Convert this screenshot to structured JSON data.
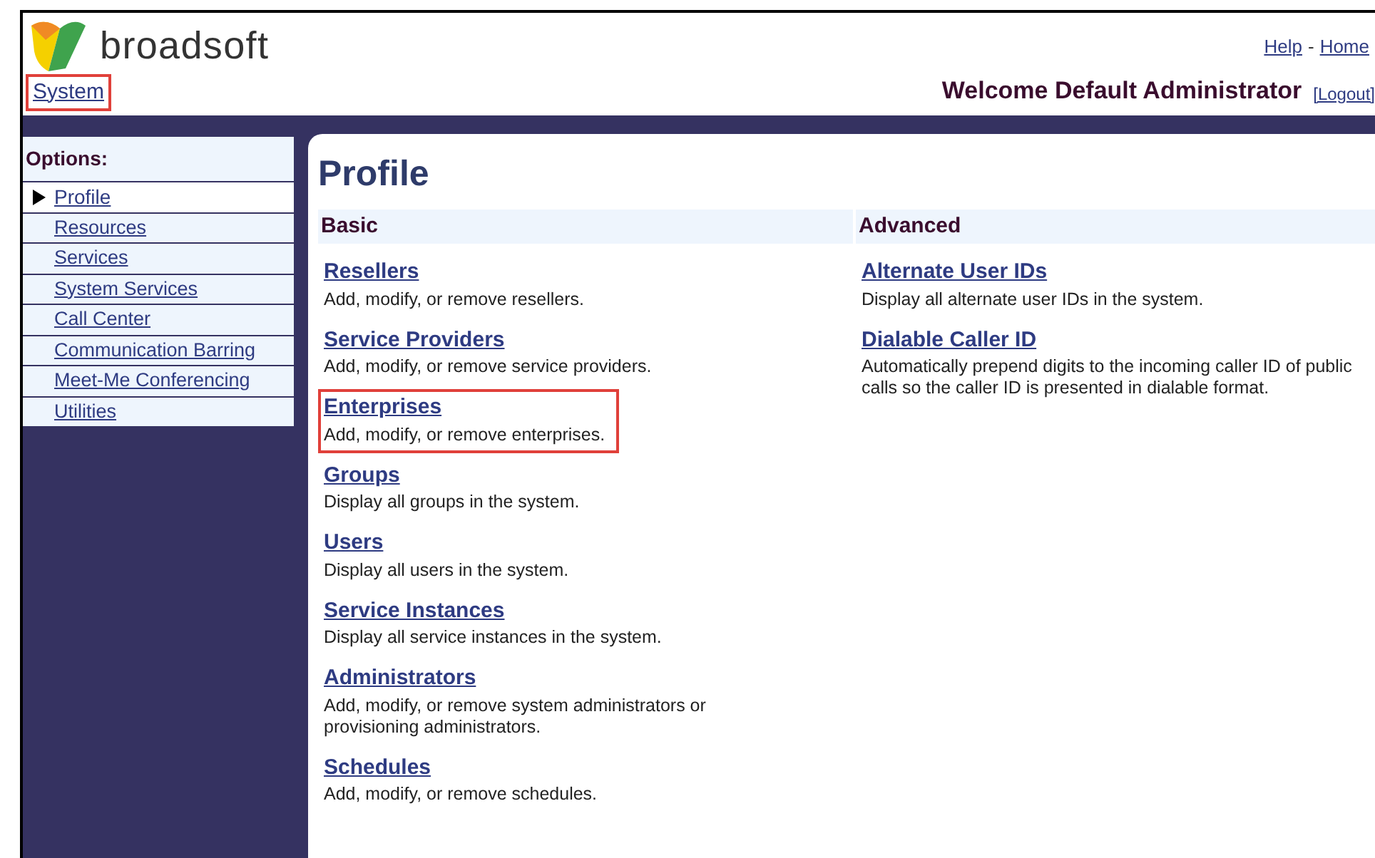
{
  "header": {
    "brand": "broadsoft",
    "links": [
      "Help",
      "Home"
    ],
    "separator": "-",
    "breadcrumb": {
      "label": "System",
      "highlighted": true
    },
    "welcome": "Welcome Default Administrator",
    "logout": "[Logout]"
  },
  "sidebar": {
    "title": "Options:",
    "items": [
      {
        "label": "Profile",
        "selected": true
      },
      {
        "label": "Resources",
        "selected": false
      },
      {
        "label": "Services",
        "selected": false
      },
      {
        "label": "System Services",
        "selected": false
      },
      {
        "label": "Call Center",
        "selected": false
      },
      {
        "label": "Communication Barring",
        "selected": false
      },
      {
        "label": "Meet-Me Conferencing",
        "selected": false
      },
      {
        "label": "Utilities",
        "selected": false
      }
    ]
  },
  "page": {
    "title": "Profile",
    "columns": [
      {
        "heading": "Basic",
        "entries": [
          {
            "link": "Resellers",
            "description": "Add, modify, or remove resellers.",
            "highlighted": false
          },
          {
            "link": "Service Providers",
            "description": "Add, modify, or remove service providers.",
            "highlighted": false
          },
          {
            "link": "Enterprises",
            "description": "Add, modify, or remove enterprises.",
            "highlighted": true
          },
          {
            "link": "Groups",
            "description": "Display all groups in the system.",
            "highlighted": false
          },
          {
            "link": "Users",
            "description": "Display all users in the system.",
            "highlighted": false
          },
          {
            "link": "Service Instances",
            "description": "Display all service instances in the system.",
            "highlighted": false
          },
          {
            "link": "Administrators",
            "description": "Add, modify, or remove system administrators or provisioning administrators.",
            "highlighted": false
          },
          {
            "link": "Schedules",
            "description": "Add, modify, or remove schedules.",
            "highlighted": false
          }
        ]
      },
      {
        "heading": "Advanced",
        "entries": [
          {
            "link": "Alternate User IDs",
            "description": "Display all alternate user IDs in the system.",
            "highlighted": false
          },
          {
            "link": "Dialable Caller ID",
            "description": "Automatically prepend digits to the incoming caller ID of public calls so the caller ID is presented in dialable format.",
            "highlighted": false
          }
        ]
      }
    ]
  }
}
